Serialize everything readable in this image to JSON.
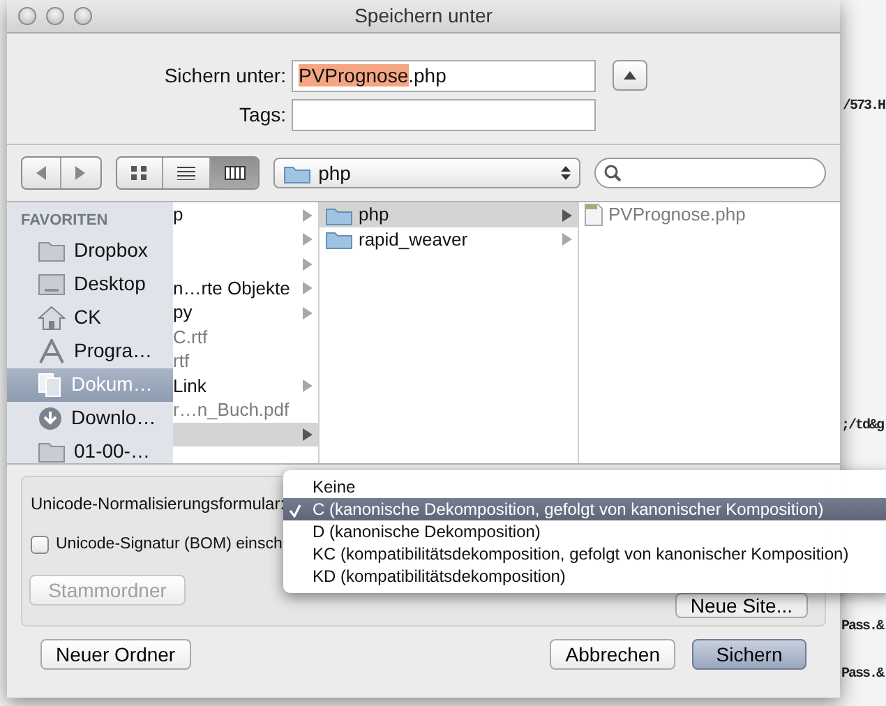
{
  "background_text": [
    {
      "text": "/573.H"
    },
    {
      "text": ";/td&g"
    },
    {
      "text": "Pass.&"
    },
    {
      "text": "Pass.&"
    }
  ],
  "window": {
    "title": "Speichern unter"
  },
  "save_as": {
    "label": "Sichern unter:",
    "selected_text": "PVPrognose",
    "rest_text": ".php"
  },
  "tags": {
    "label": "Tags:"
  },
  "toolbar": {
    "view_modes": [
      {
        "kind": "icons",
        "selected": false
      },
      {
        "kind": "list",
        "selected": false
      },
      {
        "kind": "columns",
        "selected": true
      }
    ],
    "location": "php"
  },
  "sidebar": {
    "heading": "FAVORITEN",
    "items": [
      {
        "label": "Dropbox",
        "kind": "folder",
        "selected": false
      },
      {
        "label": "Desktop",
        "kind": "desktop",
        "selected": false
      },
      {
        "label": "CK",
        "kind": "home",
        "selected": false
      },
      {
        "label": "Progra…",
        "kind": "apps",
        "selected": false
      },
      {
        "label": "Dokum…",
        "kind": "documents",
        "selected": true
      },
      {
        "label": "Downlo…",
        "kind": "download",
        "selected": false
      },
      {
        "label": "01-00-…",
        "kind": "folder",
        "selected": false
      }
    ]
  },
  "columns": [
    [
      {
        "label": "p",
        "has_arrow": true,
        "dimmed": false,
        "selected": false
      },
      {
        "has_arrow": true,
        "dimmed": false,
        "selected": false
      },
      {
        "has_arrow": true,
        "dimmed": false,
        "selected": false
      },
      {
        "label": "n…rte Objekte",
        "has_arrow": true,
        "dimmed": false,
        "selected": false
      },
      {
        "label": "py",
        "has_arrow": true,
        "dimmed": false,
        "selected": false
      },
      {
        "label": "C.rtf",
        "has_arrow": false,
        "dimmed": true,
        "selected": false
      },
      {
        "label": "rtf",
        "has_arrow": false,
        "dimmed": true,
        "selected": false
      },
      {
        "label": "Link",
        "has_arrow": true,
        "dimmed": false,
        "selected": false
      },
      {
        "label": "r…n_Buch.pdf",
        "has_arrow": false,
        "dimmed": true,
        "selected": false
      },
      {
        "has_arrow": true,
        "dimmed": false,
        "selected": true
      }
    ],
    [
      {
        "label": "php",
        "kind": "folder",
        "has_arrow": true,
        "dimmed": false,
        "selected": true
      },
      {
        "label": "rapid_weaver",
        "kind": "folder",
        "has_arrow": true,
        "dimmed": false,
        "selected": false
      }
    ],
    [
      {
        "label": "PVPrognose.php",
        "kind": "file",
        "has_arrow": false,
        "dimmed": true,
        "selected": false
      }
    ]
  ],
  "options": {
    "normalization_label": "Unicode-Normalisierungsformular:",
    "bom": {
      "label": "Unicode-Signatur (BOM) einsch",
      "checked": false
    },
    "root_button": {
      "label": "Stammordner",
      "disabled": true
    },
    "new_site_button": {
      "label": "Neue Site...",
      "disabled": false
    }
  },
  "menu": [
    {
      "label": "Keine",
      "selected": false
    },
    {
      "label": "C (kanonische Dekomposition, gefolgt von kanonischer Komposition)",
      "selected": true
    },
    {
      "label": "D (kanonische Dekomposition)",
      "selected": false
    },
    {
      "label": "KC (kompatibilitätsdekomposition, gefolgt von kanonischer Komposition)",
      "selected": false
    },
    {
      "label": "KD (kompatibilitätsdekomposition)",
      "selected": false
    }
  ],
  "buttons": [
    {
      "label": "Neuer Ordner",
      "default": false
    },
    {
      "label": "Abbrechen",
      "default": false
    },
    {
      "label": "Sichern",
      "default": true
    }
  ]
}
